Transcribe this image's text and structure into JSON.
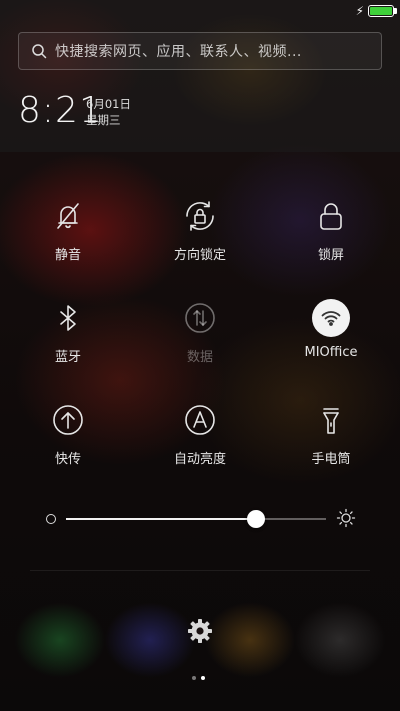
{
  "status_bar": {
    "battery_level": 1.0,
    "charging": true,
    "battery_color": "#3fd03a"
  },
  "search": {
    "placeholder": "快捷搜索网页、应用、联系人、视频..."
  },
  "clock": {
    "time": "8:21",
    "date": "6月01日",
    "weekday": "星期三"
  },
  "toggles": [
    {
      "label": "静音",
      "icon": "mute-bell-icon",
      "state": "off"
    },
    {
      "label": "方向锁定",
      "icon": "rotation-lock-icon",
      "state": "off"
    },
    {
      "label": "锁屏",
      "icon": "lock-icon",
      "state": "off"
    },
    {
      "label": "蓝牙",
      "icon": "bluetooth-icon",
      "state": "off"
    },
    {
      "label": "数据",
      "icon": "mobile-data-icon",
      "state": "disabled"
    },
    {
      "label": "MIOffice",
      "icon": "wifi-icon",
      "state": "on"
    },
    {
      "label": "快传",
      "icon": "transfer-icon",
      "state": "off"
    },
    {
      "label": "自动亮度",
      "icon": "auto-brightness-icon",
      "state": "off"
    },
    {
      "label": "手电筒",
      "icon": "flashlight-icon",
      "state": "off"
    }
  ],
  "brightness": {
    "level": 0.73
  },
  "pager": {
    "current": 2,
    "total": 2
  }
}
